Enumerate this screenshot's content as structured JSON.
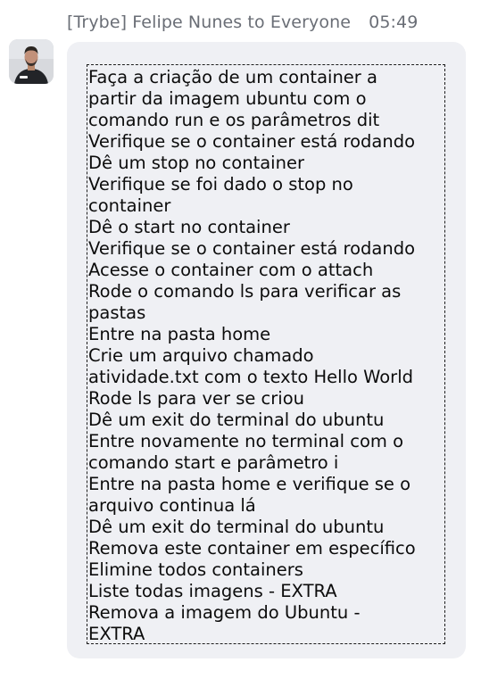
{
  "message": {
    "sender": "[Trybe] Felipe Nunes to Everyone",
    "time": "05:49",
    "avatar_icon": "user-avatar-photo",
    "lines": [
      "Faça a criação de um container a",
      "partir da imagem ubuntu com o",
      "comando run e os parâmetros dit",
      "Verifique se o container está rodando",
      "Dê um stop no container",
      "Verifique se foi dado o stop no",
      "container",
      "Dê o start no container",
      "Verifique se o container está rodando",
      "Acesse o container com o attach",
      "Rode o comando ls para verificar as",
      "pastas",
      "Entre na pasta home",
      "Crie um arquivo chamado",
      "atividade.txt com o texto Hello World",
      "Rode ls para ver se criou",
      "Dê um exit do terminal do ubuntu",
      "Entre novamente no terminal com o",
      "comando start e parâmetro i",
      "Entre na pasta home e verifique se o",
      "arquivo continua lá",
      "Dê um exit do terminal do ubuntu",
      "Remova este container em específico",
      "Elimine todos containers",
      "Liste todas imagens - EXTRA",
      "Remova a imagem do Ubuntu -",
      "EXTRA"
    ]
  }
}
